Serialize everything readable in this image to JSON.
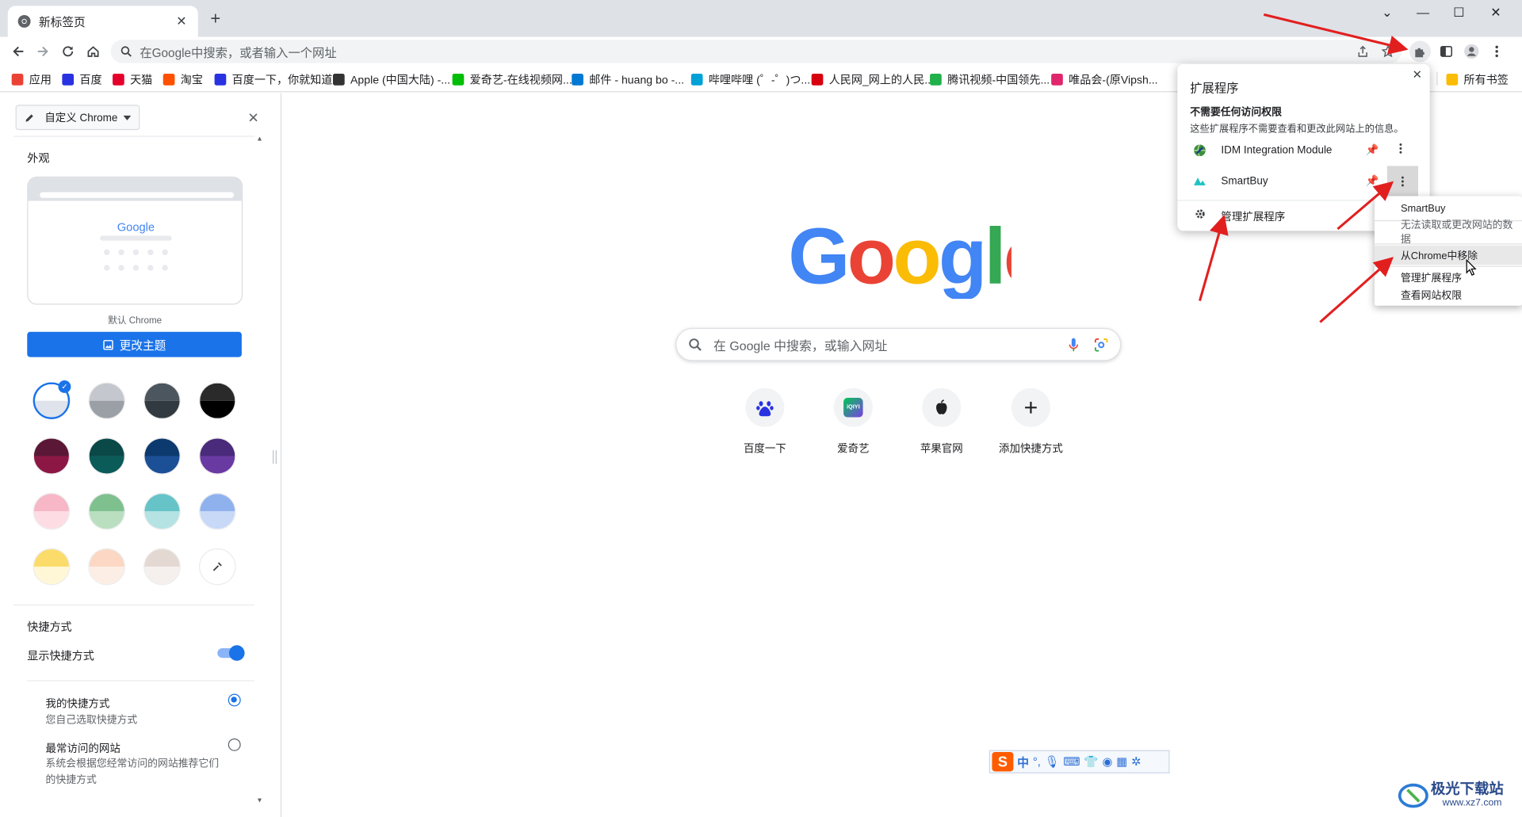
{
  "window": {
    "tab_title": "新标签页",
    "new_tab": "+",
    "min": "—",
    "max": "☐",
    "close": "✕",
    "menu_down": "⌄"
  },
  "toolbar": {
    "omnibox_placeholder": "在Google中搜索，或者输入一个网址"
  },
  "bookmarks": [
    {
      "label": "应用",
      "color": "#ea4335"
    },
    {
      "label": "百度",
      "color": "#2932e1"
    },
    {
      "label": "天猫",
      "color": "#e4002b"
    },
    {
      "label": "淘宝",
      "color": "#ff5000"
    },
    {
      "label": "百度一下，你就知道",
      "color": "#2932e1"
    },
    {
      "label": "Apple (中国大陆) -...",
      "color": "#333333"
    },
    {
      "label": "爱奇艺-在线视频网...",
      "color": "#00be06"
    },
    {
      "label": "邮件 - huang bo -...",
      "color": "#0078d4"
    },
    {
      "label": "哔哩哔哩 (゜-゜)つ...",
      "color": "#00a1d6"
    },
    {
      "label": "人民网_网上的人民...",
      "color": "#d7000f"
    },
    {
      "label": "腾讯视频-中国领先...",
      "color": "#20b14a"
    },
    {
      "label": "唯品会-(原Vipsh...",
      "color": "#e0266d"
    }
  ],
  "all_bookmarks": "所有书签",
  "side": {
    "dropdown": "自定义 Chrome",
    "appearance_title": "外观",
    "preview_caption": "默认 Chrome",
    "preview_google": "Google",
    "change_theme": "更改主题",
    "shortcuts_title": "快捷方式",
    "show_shortcuts": "显示快捷方式",
    "my_shortcuts": "我的快捷方式",
    "my_shortcuts_desc": "您自己选取快捷方式",
    "most_visited": "最常访问的网站",
    "most_visited_desc1": "系统会根据您经常访问的网站推荐它们",
    "most_visited_desc2": "的快捷方式",
    "swatches": [
      [
        "#ffffff",
        "#dee3ec"
      ],
      [
        "#c4c7cd",
        "#9aa0a6"
      ],
      [
        "#4b565f",
        "#303a40"
      ],
      [
        "#2a2a2a",
        "#000000"
      ],
      [
        "#5a1836",
        "#8c1745"
      ],
      [
        "#0b4848",
        "#0b5b58"
      ],
      [
        "#0d3a6e",
        "#1b4f96"
      ],
      [
        "#4a2a7a",
        "#6a3aa3"
      ],
      [
        "#f7b7c6",
        "#fddce4"
      ],
      [
        "#7fc08f",
        "#b9dfc0"
      ],
      [
        "#66c4c8",
        "#b5e2e3"
      ],
      [
        "#8fb2ee",
        "#c8d9f8"
      ],
      [
        "#fbdc6a",
        "#fff7d6"
      ],
      [
        "#fbd7c4",
        "#fdeee5"
      ],
      [
        "#e3d8d2",
        "#f5f0ed"
      ]
    ]
  },
  "ntp": {
    "logo": "Google",
    "search_placeholder": "在 Google 中搜索，或输入网址",
    "shortcuts": [
      {
        "label": "百度一下"
      },
      {
        "label": "爱奇艺"
      },
      {
        "label": "苹果官网"
      },
      {
        "label": "添加快捷方式"
      }
    ]
  },
  "ext_popup": {
    "title": "扩展程序",
    "section_title": "不需要任何访问权限",
    "section_desc": "这些扩展程序不需要查看和更改此网站上的信息。",
    "items": [
      "IDM Integration Module",
      "SmartBuy"
    ],
    "manage": "管理扩展程序"
  },
  "context_menu": {
    "title": "SmartBuy",
    "disabled": "无法读取或更改网站的数据",
    "remove": "从Chrome中移除",
    "manage": "管理扩展程序",
    "view_perms": "查看网站权限"
  },
  "ime": {
    "label": "中"
  },
  "watermark": {
    "text": "极光下载站",
    "url": "www.xz7.com"
  }
}
